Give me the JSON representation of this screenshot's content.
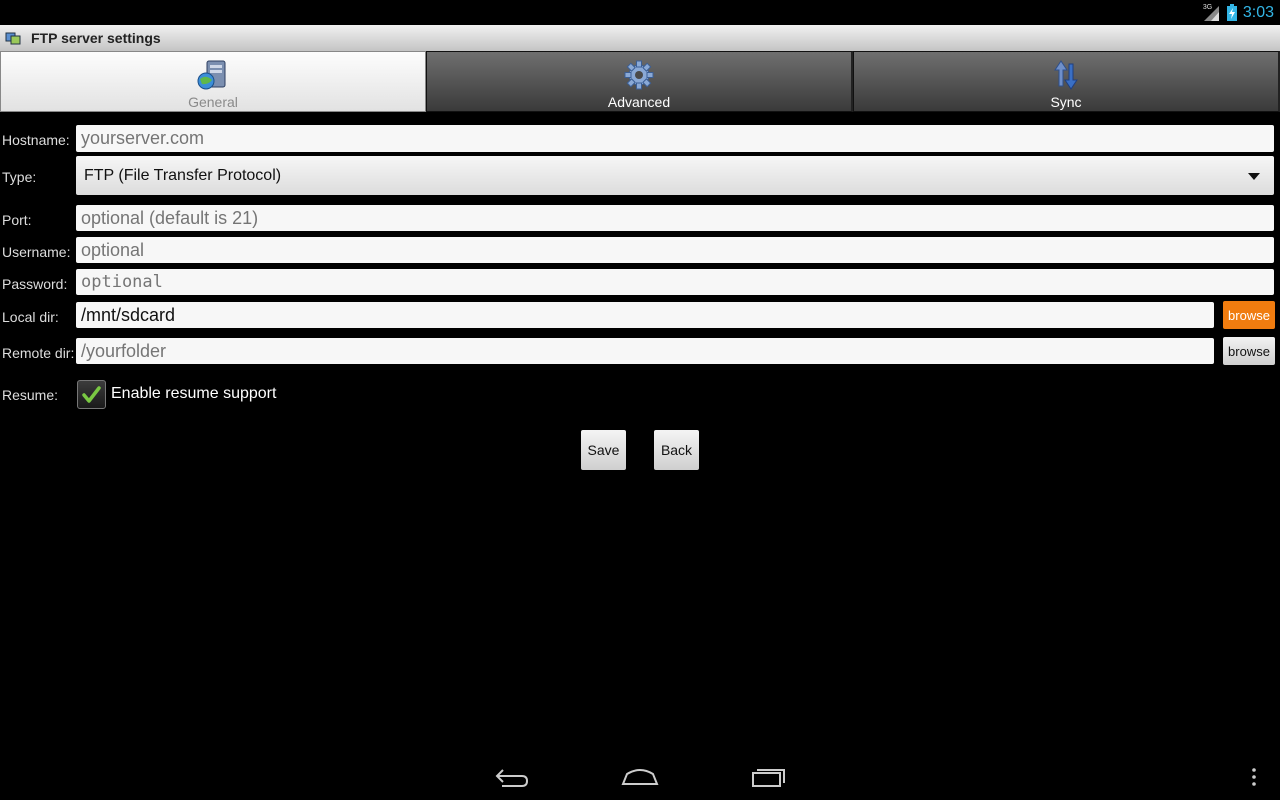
{
  "status_bar": {
    "network": "3G",
    "clock": "3:03"
  },
  "window": {
    "title": "FTP server settings"
  },
  "tabs": [
    {
      "label": "General",
      "icon": "server-icon",
      "active": true
    },
    {
      "label": "Advanced",
      "icon": "gear-icon",
      "active": false
    },
    {
      "label": "Sync",
      "icon": "sync-arrows-icon",
      "active": false
    }
  ],
  "form": {
    "hostname": {
      "label": "Hostname:",
      "value": "",
      "placeholder": "yourserver.com"
    },
    "type": {
      "label": "Type:",
      "value": "FTP (File Transfer Protocol)"
    },
    "port": {
      "label": "Port:",
      "value": "",
      "placeholder": "optional (default is 21)"
    },
    "username": {
      "label": "Username:",
      "value": "",
      "placeholder": "optional"
    },
    "password": {
      "label": "Password:",
      "value": "",
      "placeholder": "optional"
    },
    "local_dir": {
      "label": "Local dir:",
      "value": "/mnt/sdcard",
      "browse": "browse"
    },
    "remote_dir": {
      "label": "Remote dir:",
      "value": "",
      "placeholder": "/yourfolder",
      "browse": "browse"
    },
    "resume": {
      "label": "Resume:",
      "checkbox_label": "Enable resume support",
      "checked": true
    }
  },
  "actions": {
    "save": "Save",
    "back": "Back"
  },
  "colors": {
    "accent": "#33b5e5",
    "browse_active": "#f07c0f",
    "check": "#7ac943"
  }
}
